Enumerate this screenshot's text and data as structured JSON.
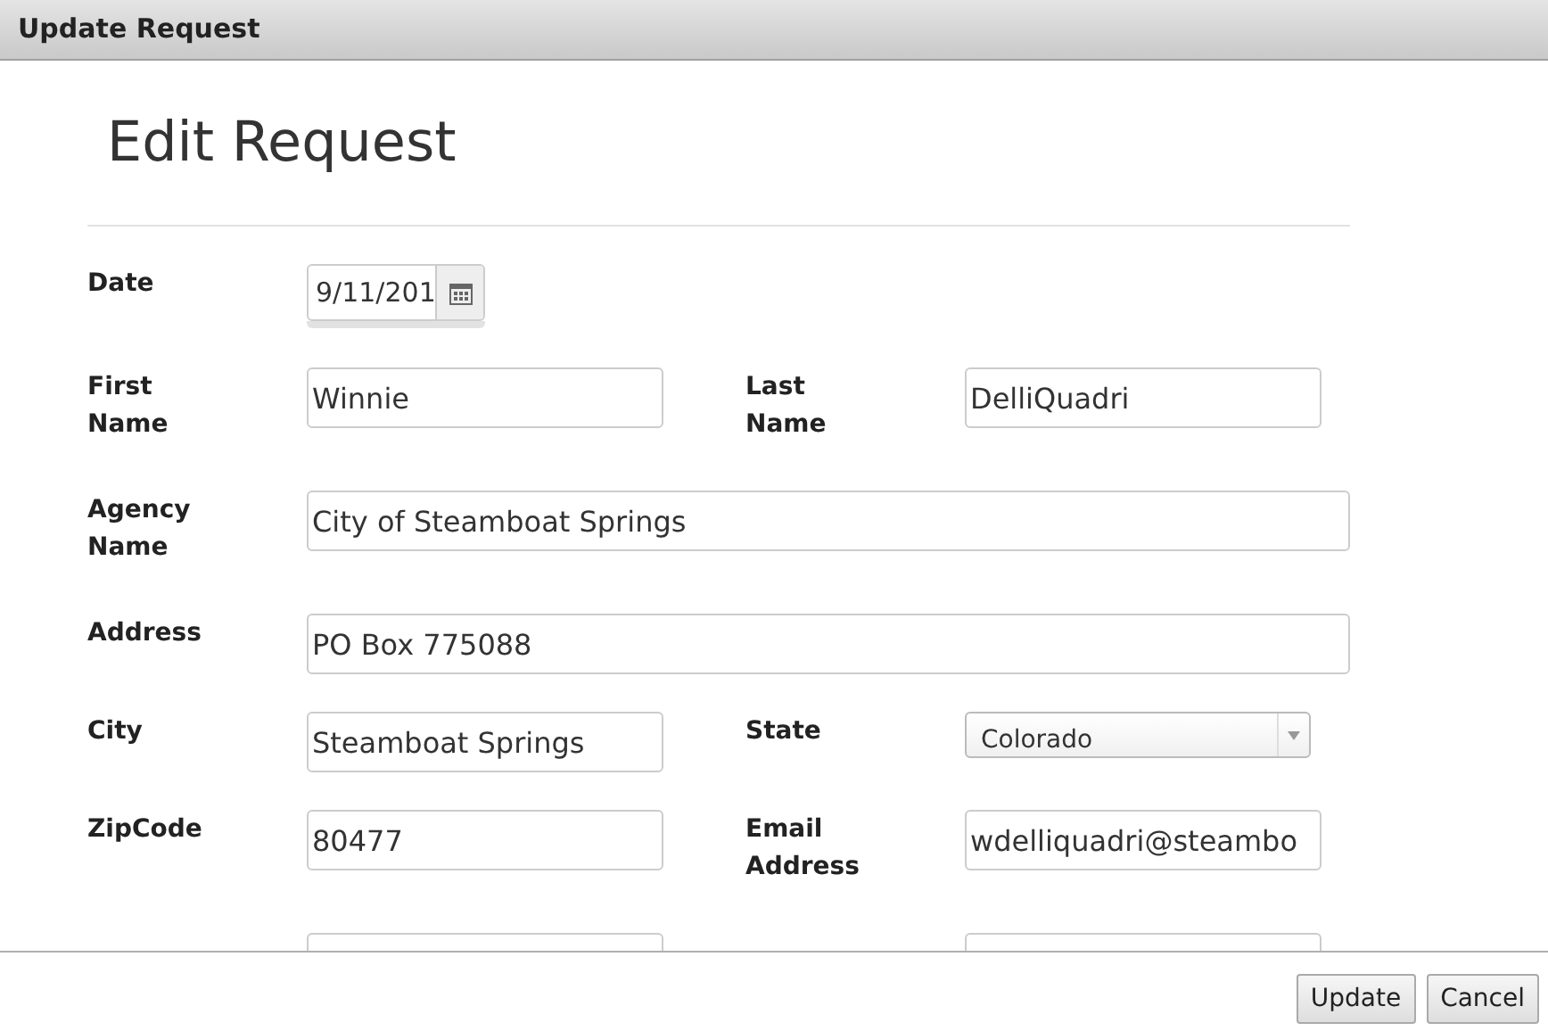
{
  "window": {
    "title": "Update Request"
  },
  "heading": "Edit Request",
  "rows": [
    {
      "kind": "date",
      "label": "Date",
      "value": "9/11/201"
    },
    {
      "kind": "pair",
      "fields": [
        {
          "kind": "text",
          "label": "First Name",
          "value": "Winnie"
        },
        {
          "kind": "text",
          "label": "Last Name",
          "value": "DelliQuadri"
        }
      ]
    },
    {
      "kind": "wide",
      "label": "Agency Name",
      "value": "City of Steamboat Springs"
    },
    {
      "kind": "wide",
      "label": "Address",
      "value": "PO Box 775088"
    },
    {
      "kind": "pair",
      "fields": [
        {
          "kind": "text",
          "label": "City",
          "value": "Steamboat Springs"
        },
        {
          "kind": "select",
          "label": "State",
          "value": "Colorado"
        }
      ]
    },
    {
      "kind": "pair",
      "fields": [
        {
          "kind": "text",
          "label": "ZipCode",
          "value": "80477"
        },
        {
          "kind": "text",
          "label": "Email Address",
          "value": "wdelliquadri@steambo"
        }
      ]
    },
    {
      "kind": "cut"
    }
  ],
  "buttons": [
    "Update",
    "Cancel"
  ]
}
